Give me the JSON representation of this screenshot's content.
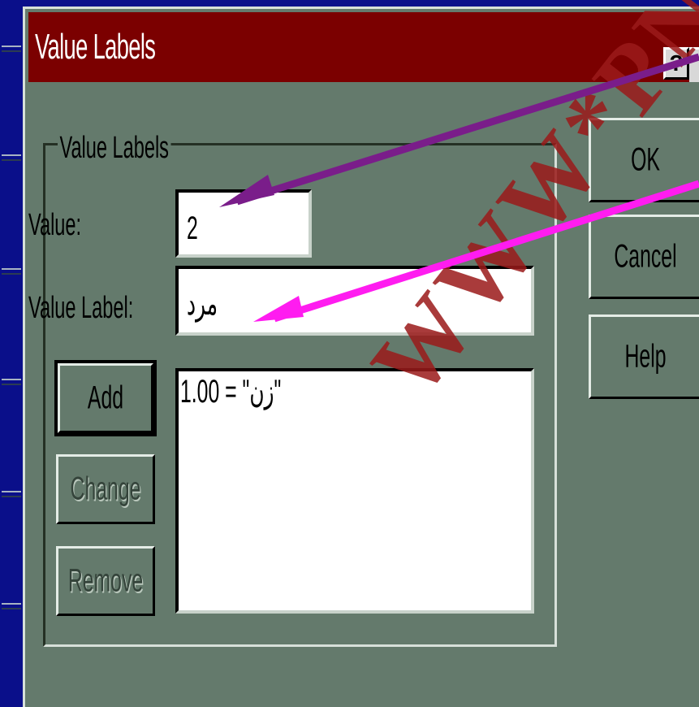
{
  "window": {
    "title": "Value Labels",
    "help_button_label": "?"
  },
  "group": {
    "label": "Value Labels"
  },
  "fields": {
    "value_label_text": "Value:",
    "value_input": "2",
    "value_label_label_text": "Value Label:",
    "value_label_input": "مرد"
  },
  "list": {
    "items": [
      "1.00 = \"زن\""
    ]
  },
  "buttons": {
    "add": "Add",
    "change": "Change",
    "remove": "Remove",
    "ok": "OK",
    "cancel": "Cancel",
    "help": "Help"
  },
  "watermark": {
    "text": "WWW*PN"
  },
  "colors": {
    "titlebar": "#7b0000",
    "dialog_bg": "#647a6c",
    "outer_bg": "#0a0f8a",
    "arrow_purple": "#7a1d8a",
    "arrow_pink": "#ff1cf0"
  }
}
